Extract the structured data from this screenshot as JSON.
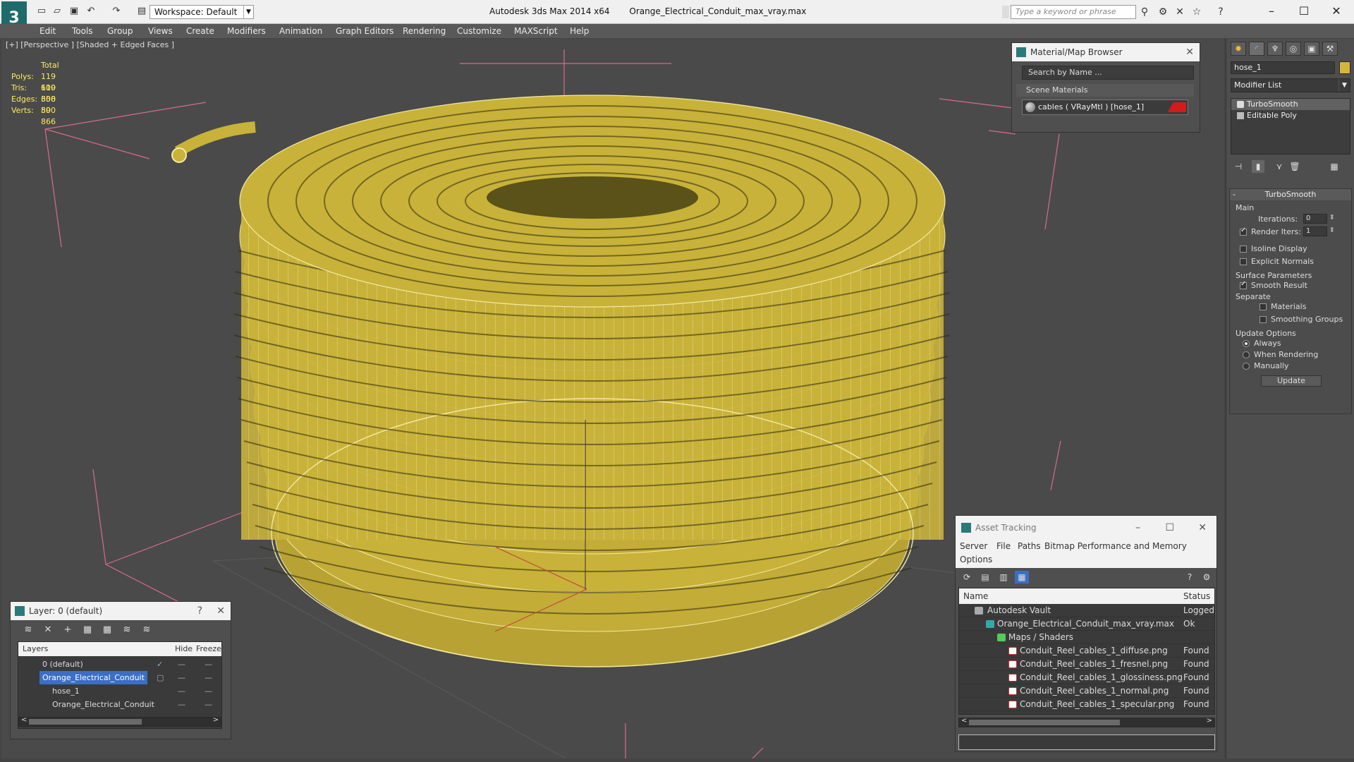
{
  "titlebar": {
    "workspace_label": "Workspace: Default",
    "app_name": "Autodesk 3ds Max  2014 x64",
    "file_name": "Orange_Electrical_Conduit_max_vray.max",
    "search_placeholder": "Type a keyword or phrase"
  },
  "menu": [
    "Edit",
    "Tools",
    "Group",
    "Views",
    "Create",
    "Modifiers",
    "Animation",
    "Graph Editors",
    "Rendering",
    "Customize",
    "MAXScript",
    "Help"
  ],
  "viewport": {
    "label": "[+] [Perspective ] [Shaded + Edged Faces ]",
    "stats": {
      "header": "Total",
      "rows": [
        {
          "k": "Polys:",
          "v": "119 600"
        },
        {
          "k": "Tris:",
          "v": "119 600"
        },
        {
          "k": "Edges:",
          "v": "358 800"
        },
        {
          "k": "Verts:",
          "v": "59 866"
        }
      ]
    },
    "colors": {
      "cable": "#c9b23a",
      "wire": "#ffffff",
      "background": "#4a4a4a"
    }
  },
  "material_browser": {
    "title": "Material/Map Browser",
    "search": "Search by Name ...",
    "section": "Scene Materials",
    "item": "cables  ( VRayMtl )  [hose_1]"
  },
  "command_panel": {
    "object_name": "hose_1",
    "modifier_list": "Modifier List",
    "stack": [
      "TurboSmooth",
      "Editable Poly"
    ],
    "turbosmooth": {
      "title": "TurboSmooth",
      "main": "Main",
      "iterations_label": "Iterations:",
      "iterations": "0",
      "render_iters_label": "Render Iters:",
      "render_iters": "1",
      "isoline": "Isoline Display",
      "explicit": "Explicit Normals",
      "surface": "Surface Parameters",
      "smooth_result": "Smooth Result",
      "separate": "Separate",
      "materials": "Materials",
      "smoothing_groups": "Smoothing Groups",
      "update_options": "Update Options",
      "always": "Always",
      "when_rendering": "When Rendering",
      "manually": "Manually",
      "update": "Update"
    }
  },
  "layer_panel": {
    "title": "Layer: 0 (default)",
    "col_layers": "Layers",
    "col_hide": "Hide",
    "col_freeze": "Freeze",
    "rows": [
      "0 (default)",
      "Orange_Electrical_Conduit",
      "hose_1",
      "Orange_Electrical_Conduit"
    ]
  },
  "asset_tracking": {
    "title": "Asset Tracking",
    "menu": [
      "Server",
      "File",
      "Paths",
      "Bitmap Performance and Memory",
      "Options"
    ],
    "col_name": "Name",
    "col_status": "Status",
    "rows": [
      {
        "name": "Autodesk Vault",
        "status": "Logged"
      },
      {
        "name": "Orange_Electrical_Conduit_max_vray.max",
        "status": "Ok"
      },
      {
        "name": "Maps / Shaders",
        "status": ""
      },
      {
        "name": "Conduit_Reel_cables_1_diffuse.png",
        "status": "Found"
      },
      {
        "name": "Conduit_Reel_cables_1_fresnel.png",
        "status": "Found"
      },
      {
        "name": "Conduit_Reel_cables_1_glossiness.png",
        "status": "Found"
      },
      {
        "name": "Conduit_Reel_cables_1_normal.png",
        "status": "Found"
      },
      {
        "name": "Conduit_Reel_cables_1_specular.png",
        "status": "Found"
      }
    ]
  }
}
